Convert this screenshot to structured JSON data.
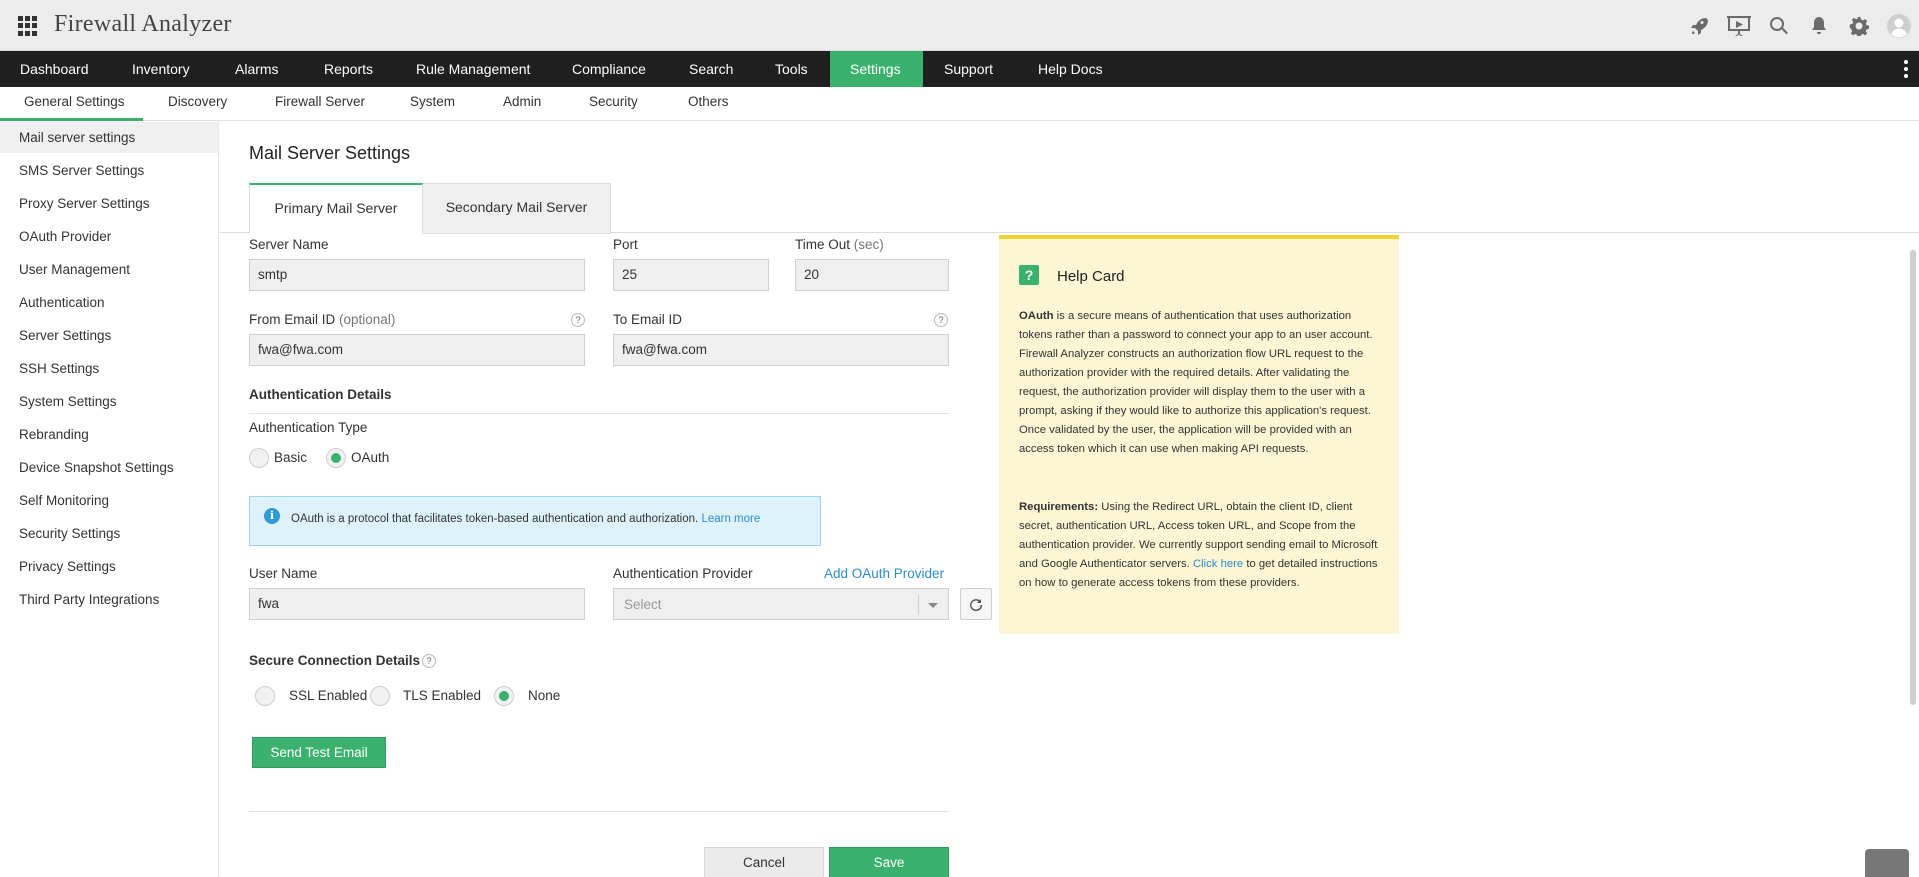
{
  "app": {
    "title": "Firewall Analyzer"
  },
  "header_icons": [
    "rocket-icon",
    "presentation-icon",
    "search-icon",
    "bell-icon",
    "gear-icon",
    "user-avatar-icon"
  ],
  "main_nav": {
    "tabs": [
      "Dashboard",
      "Inventory",
      "Alarms",
      "Reports",
      "Rule Management",
      "Compliance",
      "Search",
      "Tools",
      "Settings",
      "Support",
      "Help Docs"
    ],
    "active": "Settings"
  },
  "sub_nav": {
    "tabs": [
      "General Settings",
      "Discovery",
      "Firewall Server",
      "System",
      "Admin",
      "Security",
      "Others"
    ],
    "active": "General Settings"
  },
  "sidebar": {
    "items": [
      "Mail server settings",
      "SMS Server Settings",
      "Proxy Server Settings",
      "OAuth Provider",
      "User Management",
      "Authentication",
      "Server Settings",
      "SSH Settings",
      "System Settings",
      "Rebranding",
      "Device Snapshot Settings",
      "Self Monitoring",
      "Security Settings",
      "Privacy Settings",
      "Third Party Integrations"
    ],
    "active": "Mail server settings"
  },
  "page": {
    "title": "Mail Server Settings",
    "tabs": [
      "Primary Mail Server",
      "Secondary Mail Server"
    ],
    "active_tab": "Primary Mail Server"
  },
  "form": {
    "server_name": {
      "label": "Server Name",
      "value": "smtp"
    },
    "port": {
      "label": "Port",
      "value": "25"
    },
    "timeout": {
      "label": "Time Out",
      "unit": "(sec)",
      "value": "20"
    },
    "from_email": {
      "label": "From Email ID",
      "hint": "(optional)",
      "value": "fwa@fwa.com"
    },
    "to_email": {
      "label": "To Email ID",
      "value": "fwa@fwa.com"
    },
    "help_mark": "?",
    "auth_section_title": "Authentication Details",
    "auth_type": {
      "label": "Authentication Type",
      "options": [
        "Basic",
        "OAuth"
      ],
      "selected": "OAuth"
    },
    "info": {
      "icon": "info-icon",
      "text": "OAuth is a protocol that facilitates token-based authentication and authorization.",
      "link": "Learn more"
    },
    "user_name": {
      "label": "User Name",
      "value": "fwa"
    },
    "auth_provider": {
      "label": "Authentication Provider",
      "add_link": "Add OAuth Provider",
      "placeholder": "Select"
    },
    "secure_section_title": "Secure Connection Details",
    "secure_options": [
      "SSL Enabled",
      "TLS Enabled",
      "None"
    ],
    "secure_selected": "None",
    "send_test_label": "Send Test Email",
    "cancel_label": "Cancel",
    "save_label": "Save"
  },
  "help_card": {
    "icon_text": "?",
    "title": "Help Card",
    "p1_strong": "OAuth",
    "p1": " is a secure means of authentication that uses authorization tokens rather than a password to connect your app to an user account. Firewall Analyzer constructs an authorization flow URL request to the authorization provider with the required details. After validating the request, the authorization provider will display them to the user with a prompt, asking if they would like to authorize this application's request. Once validated by the user, the application will be provided with an access token which it can use when making API requests.",
    "p2_strong": "Requirements:",
    "p2_a": " Using the Redirect URL, obtain the client ID, client secret, authentication URL, Access token URL, and Scope from the authentication provider. We currently support sending email to Microsoft and Google Authenticator servers. ",
    "p2_link": "Click here",
    "p2_b": " to get detailed instructions on how to generate access tokens from these providers."
  },
  "colors": {
    "accent": "#3ab26d",
    "nav_bg": "#1f1f1f",
    "help_bg": "#fdf6d4",
    "info_bg": "#def2fb",
    "link": "#2b8dcc"
  }
}
